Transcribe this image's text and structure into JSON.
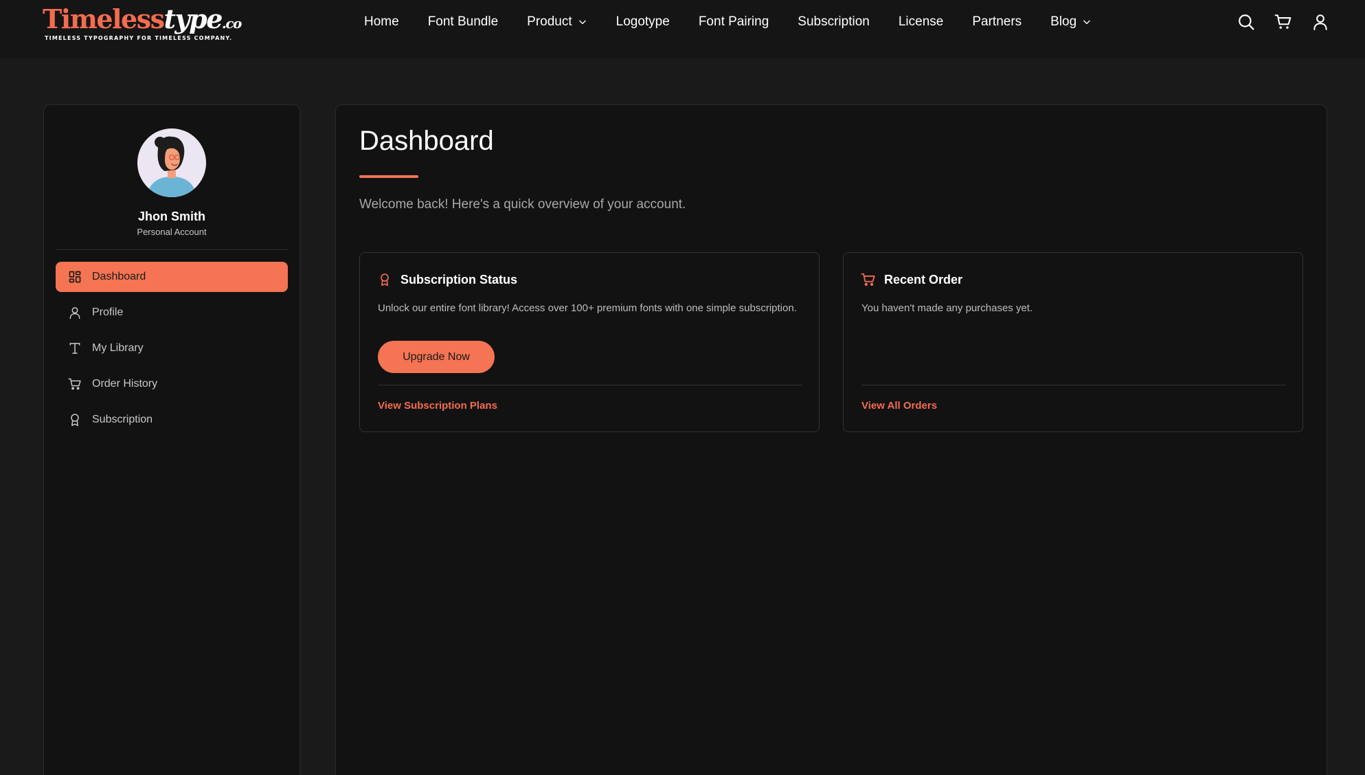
{
  "brand": {
    "logo_part1": "Timeless",
    "logo_part2": "type",
    "logo_part3": ".co",
    "tagline": "TIMELESS TYPOGRAPHY FOR TIMELESS COMPANY.",
    "accent_color": "#f47453"
  },
  "nav": {
    "items": [
      {
        "label": "Home",
        "has_dropdown": false
      },
      {
        "label": "Font Bundle",
        "has_dropdown": false
      },
      {
        "label": "Product",
        "has_dropdown": true
      },
      {
        "label": "Logotype",
        "has_dropdown": false
      },
      {
        "label": "Font Pairing",
        "has_dropdown": false
      },
      {
        "label": "Subscription",
        "has_dropdown": false
      },
      {
        "label": "License",
        "has_dropdown": false
      },
      {
        "label": "Partners",
        "has_dropdown": false
      },
      {
        "label": "Blog",
        "has_dropdown": true
      }
    ],
    "icons": [
      "search-icon",
      "cart-icon",
      "user-icon"
    ]
  },
  "sidebar": {
    "user_name": "Jhon Smith",
    "account_type": "Personal Account",
    "items": [
      {
        "label": "Dashboard",
        "icon": "dashboard-icon",
        "active": true
      },
      {
        "label": "Profile",
        "icon": "user-icon",
        "active": false
      },
      {
        "label": "My Library",
        "icon": "type-icon",
        "active": false
      },
      {
        "label": "Order History",
        "icon": "cart-icon",
        "active": false
      },
      {
        "label": "Subscription",
        "icon": "award-icon",
        "active": false
      }
    ]
  },
  "main": {
    "title": "Dashboard",
    "welcome": "Welcome back! Here's a quick overview of your account.",
    "subscription_card": {
      "icon": "award-icon",
      "title": "Subscription Status",
      "text": "Unlock our entire font library! Access over 100+ premium fonts with one simple subscription.",
      "button": "Upgrade Now",
      "link": "View Subscription Plans"
    },
    "order_card": {
      "icon": "cart-icon",
      "title": "Recent Order",
      "text": "You haven't made any purchases yet.",
      "link": "View All Orders"
    }
  }
}
